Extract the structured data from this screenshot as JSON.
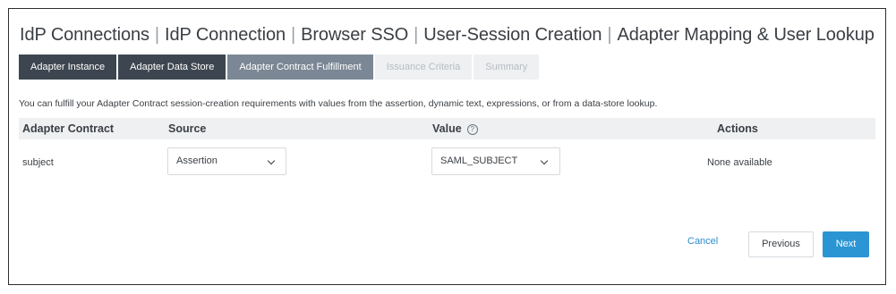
{
  "breadcrumb": {
    "items": [
      "IdP Connections",
      "IdP Connection",
      "Browser SSO",
      "User-Session Creation",
      "Adapter Mapping & User Lookup"
    ],
    "separator": "|"
  },
  "tabs": [
    {
      "label": "Adapter Instance",
      "state": "done"
    },
    {
      "label": "Adapter Data Store",
      "state": "done"
    },
    {
      "label": "Adapter Contract Fulfillment",
      "state": "active"
    },
    {
      "label": "Issuance Criteria",
      "state": "inactive"
    },
    {
      "label": "Summary",
      "state": "inactive"
    }
  ],
  "intro_text": "You can fulfill your Adapter Contract session-creation requirements with values from the assertion, dynamic text, expressions, or from a data-store lookup.",
  "table": {
    "headers": {
      "contract": "Adapter Contract",
      "source": "Source",
      "value": "Value",
      "actions": "Actions"
    },
    "info_icon": "?",
    "rows": [
      {
        "contract": "subject",
        "source": "Assertion",
        "value": "SAML_SUBJECT",
        "actions": "None available"
      }
    ]
  },
  "buttons": {
    "cancel": "Cancel",
    "previous": "Previous",
    "next": "Next"
  },
  "colors": {
    "primary": "#2b95d3",
    "tab_done": "#3d4650",
    "tab_active": "#7b8794",
    "tab_inactive": "#eef0f2"
  }
}
